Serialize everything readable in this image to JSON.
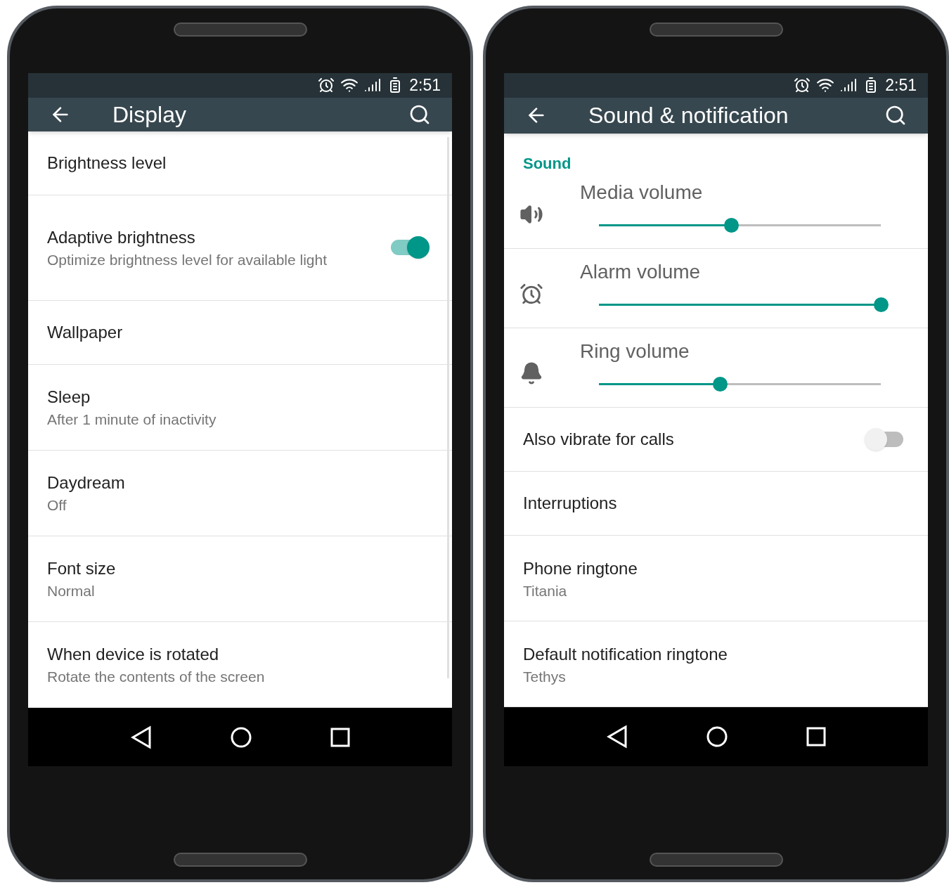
{
  "phones": [
    {
      "status_bar": {
        "time": "2:51"
      },
      "toolbar": {
        "title": "Display"
      },
      "scrollbar": true,
      "items": [
        {
          "kind": "text",
          "title": "Brightness level"
        },
        {
          "kind": "switch",
          "title": "Adaptive brightness",
          "summary": "Optimize brightness level for available light",
          "on": true
        },
        {
          "kind": "text",
          "title": "Wallpaper"
        },
        {
          "kind": "text",
          "title": "Sleep",
          "summary": "After 1 minute of inactivity"
        },
        {
          "kind": "text",
          "title": "Daydream",
          "summary": "Off"
        },
        {
          "kind": "text",
          "title": "Font size",
          "summary": "Normal"
        },
        {
          "kind": "text",
          "title": "When device is rotated",
          "summary": "Rotate the contents of the screen"
        }
      ]
    },
    {
      "status_bar": {
        "time": "2:51"
      },
      "toolbar": {
        "title": "Sound & notification"
      },
      "scrollbar": false,
      "items": [
        {
          "kind": "slider",
          "header": "Sound",
          "title": "Media volume",
          "level": 0.47
        },
        {
          "kind": "slider",
          "title": "Alarm volume",
          "level": 1.0
        },
        {
          "kind": "slider",
          "title": "Ring volume",
          "level": 0.43
        },
        {
          "kind": "switch",
          "title": "Also vibrate for calls",
          "on": false
        },
        {
          "kind": "text",
          "title": "Interruptions"
        },
        {
          "kind": "text",
          "title": "Phone ringtone",
          "summary": "Titania"
        },
        {
          "kind": "text",
          "title": "Default notification ringtone",
          "summary": "Tethys"
        }
      ]
    }
  ]
}
